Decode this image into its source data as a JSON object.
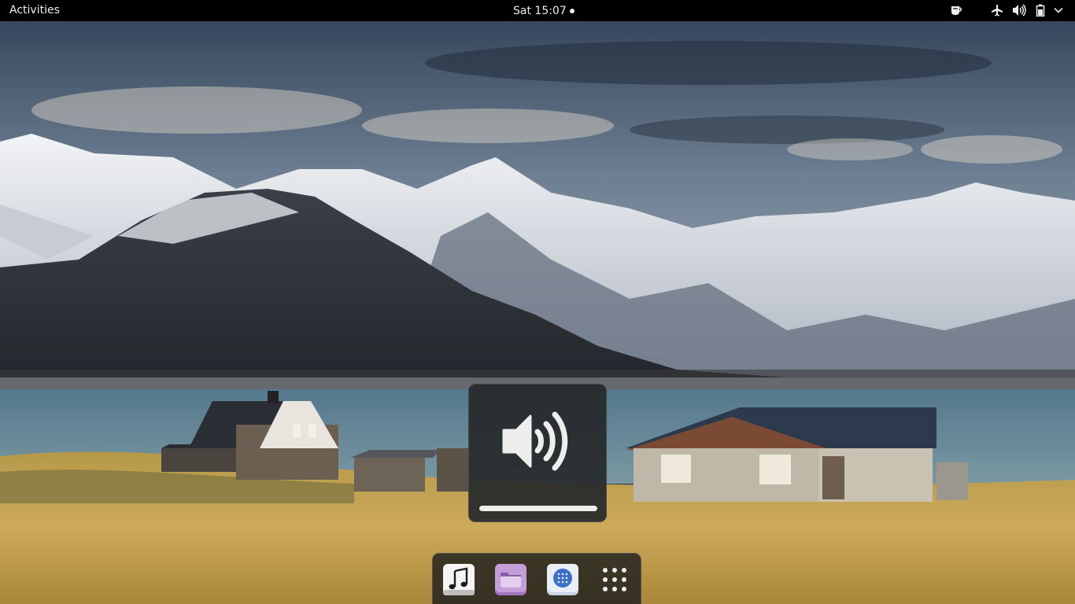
{
  "topbar": {
    "activities_label": "Activities",
    "clock_label": "Sat 15:07",
    "tray_icons": [
      "coffee-cup-icon",
      "airplane-mode-icon",
      "volume-icon",
      "battery-icon",
      "chevron-down-icon"
    ]
  },
  "osd": {
    "icon": "audio-volume-high-icon",
    "level_percent": 100
  },
  "dash": {
    "items": [
      {
        "name": "music-app",
        "icon": "music-note-icon",
        "color": "#f6f5f4"
      },
      {
        "name": "files-app",
        "icon": "folder-icon",
        "color": "#c49ed6"
      },
      {
        "name": "web-app",
        "icon": "web-grid-icon",
        "color": "#e9eef7"
      },
      {
        "name": "show-apps",
        "icon": "grid-dots-icon",
        "color": "#eeeeec"
      }
    ]
  },
  "colors": {
    "topbar_bg": "#000000",
    "text": "#eeeeec",
    "osd_bg": "#26282a",
    "music_blue": "#3d6fc8"
  }
}
